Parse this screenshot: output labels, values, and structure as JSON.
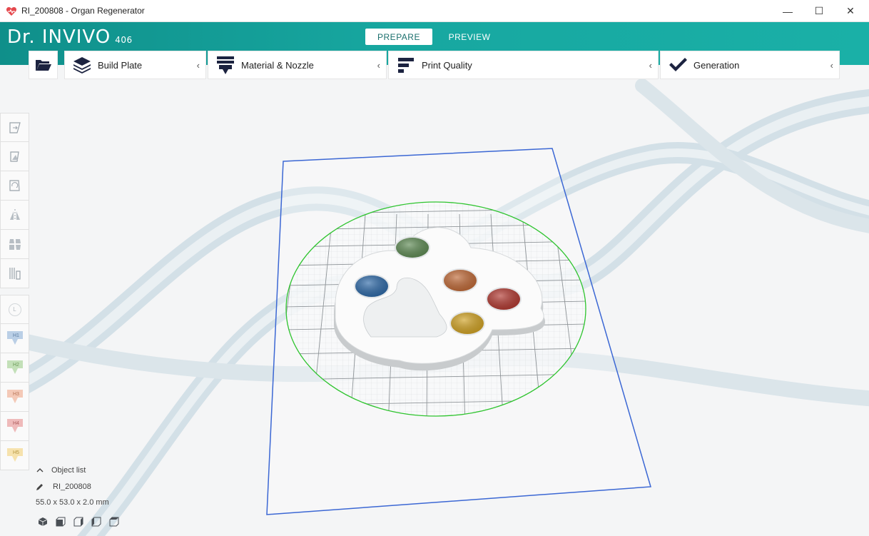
{
  "window": {
    "title": "RI_200808 - Organ Regenerator",
    "controls": [
      "—",
      "☐",
      "✕"
    ]
  },
  "header": {
    "logo": "Dr. INVIVO",
    "version": "406",
    "tabs": [
      {
        "label": "PREPARE",
        "active": true
      },
      {
        "label": "PREVIEW",
        "active": false
      }
    ],
    "accent_color": "#17a7a0"
  },
  "toolbar": {
    "open_icon": "folder-open-icon",
    "items": [
      {
        "label": "Build Plate",
        "icon": "layers-icon"
      },
      {
        "label": "Material & Nozzle",
        "icon": "nozzle-icon"
      },
      {
        "label": "Print Quality",
        "icon": "quality-bars-icon"
      },
      {
        "label": "Generation",
        "icon": "checkmark-icon"
      }
    ],
    "chevron": "‹"
  },
  "sidebar": {
    "tools": [
      "move-icon",
      "scale-icon",
      "rotate-icon",
      "mirror-icon",
      "multiply-icon",
      "support-icon"
    ],
    "layer_label": "L",
    "heads": [
      {
        "label": "H1",
        "color": "#8fb3d9"
      },
      {
        "label": "H2",
        "color": "#9fcf8c"
      },
      {
        "label": "H3",
        "color": "#f0a88a"
      },
      {
        "label": "H4",
        "color": "#e88f8f"
      },
      {
        "label": "H5",
        "color": "#f3d27a"
      }
    ]
  },
  "object_list": {
    "toggle_label": "Object list",
    "object_name": "RI_200808",
    "dimensions": "55.0 x 53.0 x 2.0 mm"
  },
  "view_icons": [
    "view-iso-icon",
    "view-front-icon",
    "view-side-icon",
    "view-left-icon",
    "view-top-icon"
  ],
  "scene": {
    "wells": [
      {
        "color": "#5f8b55"
      },
      {
        "color": "#2f6aa8"
      },
      {
        "color": "#c06a38"
      },
      {
        "color": "#b23a32"
      },
      {
        "color": "#d1a325"
      }
    ],
    "plate_outline_color": "#2b57c9",
    "bed_circle_color": "#2ec42e"
  }
}
